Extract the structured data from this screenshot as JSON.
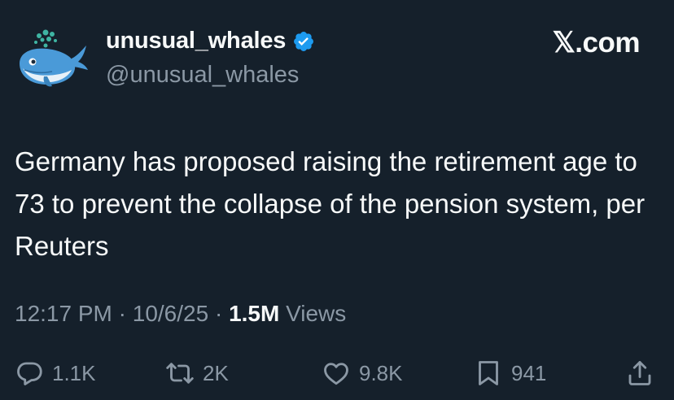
{
  "header": {
    "display_name": "unusual_whales",
    "handle": "@unusual_whales",
    "brand": "𝕏.com"
  },
  "tweet": {
    "text": "Germany has proposed raising the retirement age to 73 to prevent the collapse of the pension system, per Reuters"
  },
  "meta": {
    "time": "12:17 PM",
    "date": "10/6/25",
    "sep": "·",
    "views_count": "1.5M",
    "views_label": "Views"
  },
  "actions": {
    "replies": "1.1K",
    "reposts": "2K",
    "likes": "9.8K",
    "bookmarks": "941"
  },
  "colors": {
    "background": "#15202b",
    "text": "#f7f9f9",
    "muted": "#8b98a5",
    "verified": "#1d9bf0"
  },
  "icons": [
    "whale-avatar",
    "verified-badge-icon",
    "reply-icon",
    "repost-icon",
    "like-icon",
    "bookmark-icon",
    "share-icon"
  ]
}
